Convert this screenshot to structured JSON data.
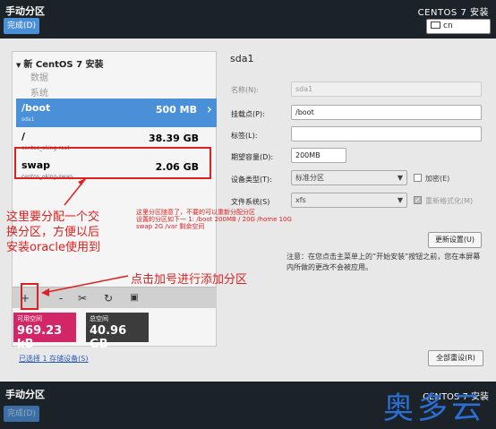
{
  "header": {
    "title": "手动分区",
    "done_label": "完成(D)",
    "product": "CENTOS 7 安装",
    "keyboard": "cn"
  },
  "left_panel": {
    "group_title": "新 CentOS 7 安装",
    "sub_data": "数据",
    "sub_system": "系统",
    "partitions": [
      {
        "name": "/boot",
        "device": "sda1",
        "size": "500 MB"
      },
      {
        "name": "/",
        "device": "centos_oking-root",
        "size": "38.39 GB"
      },
      {
        "name": "swap",
        "device": "centos_oking-swap",
        "size": "2.06 GB"
      }
    ],
    "toolbar": {
      "add": "+",
      "remove": "-",
      "tools": "✂",
      "refresh": "↻",
      "disk": "▣"
    }
  },
  "space": {
    "available_label": "可用空间",
    "available_value": "969.23 kB",
    "total_label": "总空间",
    "total_value": "40.96 GB"
  },
  "selected_devices_link": "已选择 1 存储设备(S)",
  "right_panel": {
    "title": "sda1",
    "name_label": "名称(N):",
    "name_value": "sda1",
    "mount_label": "挂载点(P):",
    "mount_value": "/boot",
    "tag_label": "标签(L):",
    "tag_value": "",
    "capacity_label": "期望容量(D):",
    "capacity_value": "200MB",
    "device_type_label": "设备类型(T):",
    "device_type_value": "标准分区",
    "encrypt_label": "加密(E)",
    "fs_label": "文件系统(S)",
    "fs_value": "xfs",
    "reformat_label": "重新格式化(M)",
    "update_button": "更新设置(U)",
    "note": "注意：在您点击主菜单上的“开始安装”按钮之前，您在本屏幕内所做的更改不会被应用。",
    "reset_button": "全部重设(R)"
  },
  "annotations": {
    "left_text": "这里要分配一个交换分区，方便以后安装oracle使用到",
    "plus_text": "点击加号进行添加分区",
    "small_text_1": "这里分区随意了，不要的可以重新分配分区",
    "small_text_2": "设置的分区如下一 1: /boot 200MB  / 20G  /home 10G",
    "small_text_3": "swap 2G  /var 剩余空间"
  },
  "footer": {
    "title": "手动分区",
    "done_label": "完成(D)",
    "product": "CENTOS 7 安装",
    "watermark": "奥多云"
  }
}
